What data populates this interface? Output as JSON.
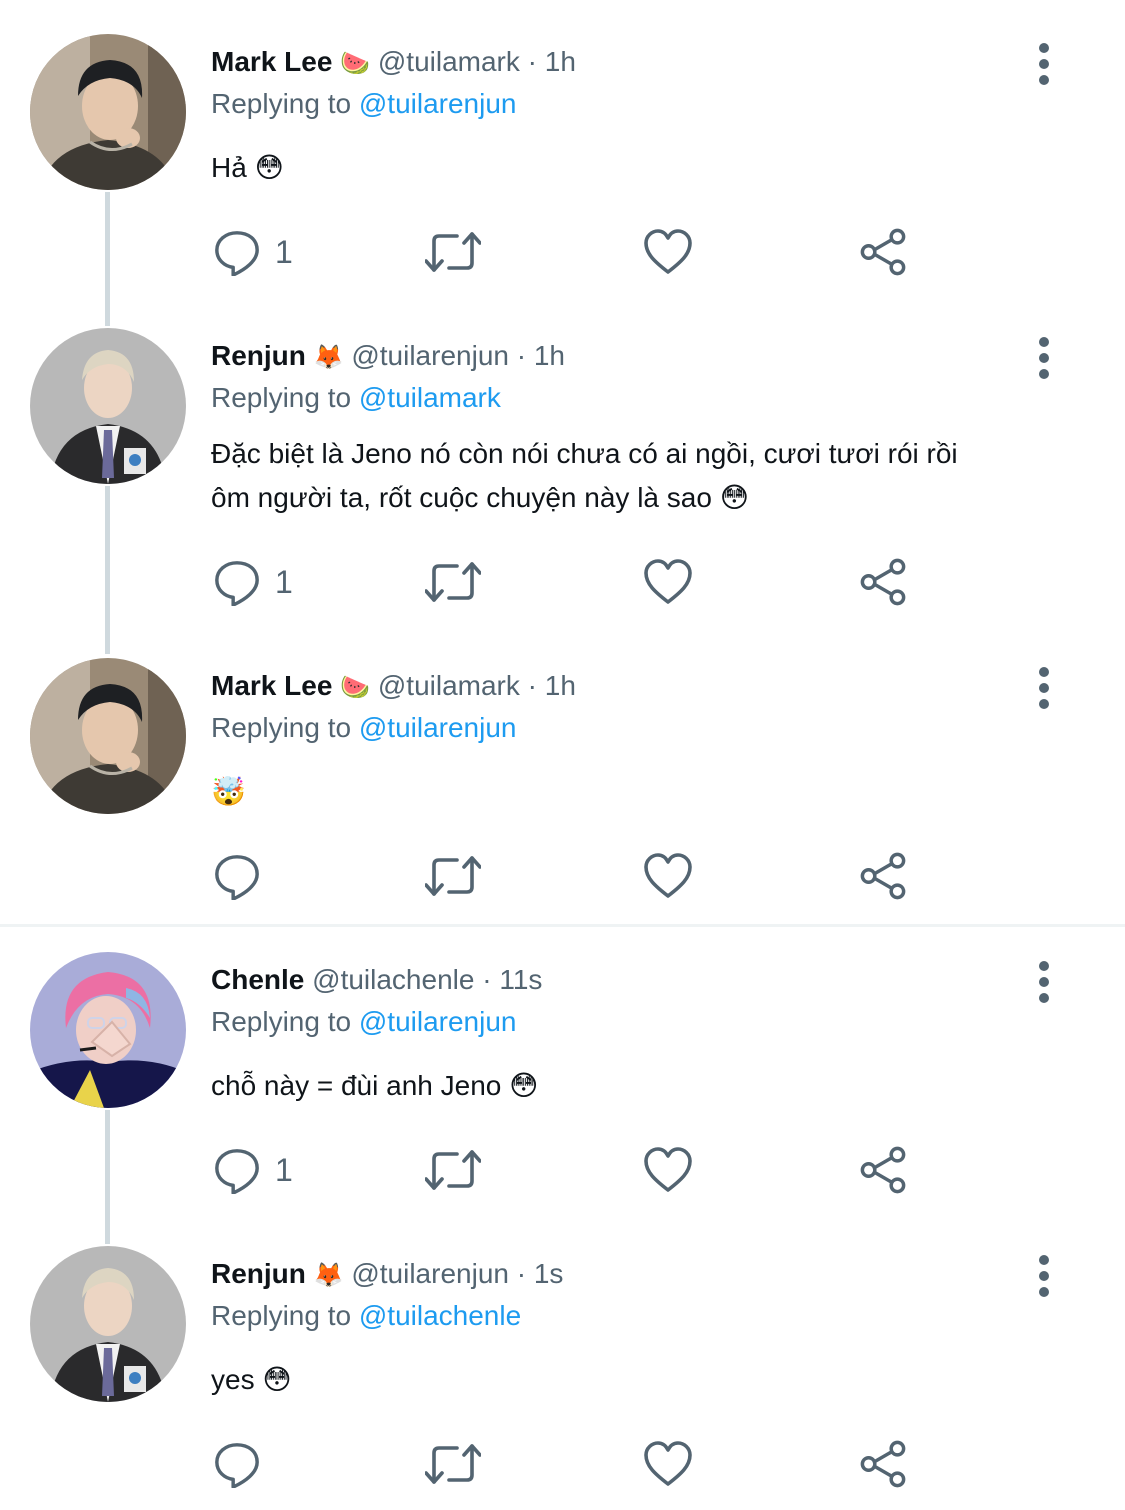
{
  "tweets": [
    {
      "name": "Mark Lee",
      "name_emoji": "🍉",
      "handle": "@tuilamark",
      "time": "1h",
      "replying_label": "Replying to",
      "replying_to": "@tuilarenjun",
      "text": "Hả 😳",
      "reply_count": "1",
      "avatar": "mark-lee-avatar"
    },
    {
      "name": "Renjun",
      "name_emoji": "🦊",
      "handle": "@tuilarenjun",
      "time": "1h",
      "replying_label": "Replying to",
      "replying_to": "@tuilamark",
      "text_line1": "Đặc biệt là Jeno nó còn nói chưa có ai ngồi, cươi tươi rói rồi",
      "text_line2": "ôm người ta, rốt cuộc chuyện này là sao 😳",
      "reply_count": "1",
      "avatar": "renjun-avatar"
    },
    {
      "name": "Mark Lee",
      "name_emoji": "🍉",
      "handle": "@tuilamark",
      "time": "1h",
      "replying_label": "Replying to",
      "replying_to": "@tuilarenjun",
      "text": "🤯",
      "reply_count": "",
      "avatar": "mark-lee-avatar"
    },
    {
      "name": "Chenle",
      "name_emoji": "",
      "handle": "@tuilachenle",
      "time": "11s",
      "replying_label": "Replying to",
      "replying_to": "@tuilarenjun",
      "text": "chỗ này = đùi anh Jeno 😳",
      "reply_count": "1",
      "avatar": "chenle-avatar"
    },
    {
      "name": "Renjun",
      "name_emoji": "🦊",
      "handle": "@tuilarenjun",
      "time": "1s",
      "replying_label": "Replying to",
      "replying_to": "@tuilachenle",
      "text": "yes 😳",
      "reply_count": "",
      "avatar": "renjun-avatar"
    }
  ],
  "separator": " · ",
  "colors": {
    "link": "#1d9bf0",
    "secondary_text": "#536471",
    "thread_line": "#cfd9de"
  },
  "icons": [
    "reply-icon",
    "retweet-icon",
    "like-icon",
    "share-icon",
    "more-icon"
  ]
}
